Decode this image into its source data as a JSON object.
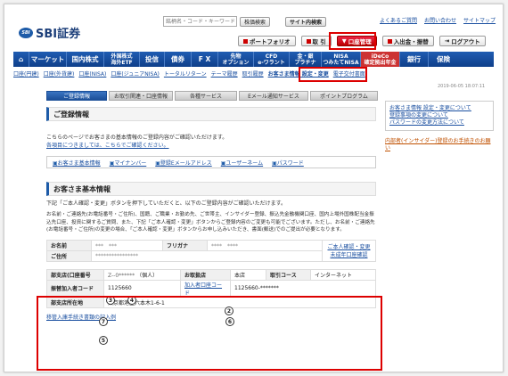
{
  "header": {
    "logo_text": "SBI証券",
    "logo_mark": "SBI",
    "search_placeholder": "銘柄名・コード・キーワード",
    "search_stock_button": "株価検索",
    "site_search_button": "サイト内検索",
    "top_links": [
      "よくあるご質問",
      "お問い合わせ",
      "サイトマップ"
    ],
    "portfolio": "ポートフォリオ",
    "trade": "取 引",
    "account_mgmt": "口座管理",
    "deposit": "入出金・振替",
    "logout": "ログアウト"
  },
  "nav": {
    "items": [
      "マーケット",
      "国内株式",
      "外国株式\n海外ETF",
      "投信",
      "債券",
      "F X",
      "先物\nオプション",
      "CFD\ne-ワラント",
      "金・銀\nプラチナ",
      "NISA\nつみたてNISA",
      "iDeCo\n確定拠出年金",
      "銀行",
      "保険"
    ]
  },
  "subnav": {
    "items": [
      "口座(円建)",
      "口座(外貨建)",
      "口座(NISA)",
      "口座(ジュニアNISA)",
      "トータルリターン",
      "テーマ履歴",
      "取引履歴",
      "お客さま情報 設定・変更",
      "電子交付書面"
    ]
  },
  "timestamp": "2019-06-05 18:07:11",
  "tabs": [
    "ご登録情報",
    "お取引関連・口座情報",
    "各種サービス",
    "Eメール通知サービス",
    "ポイントプログラム"
  ],
  "section1": {
    "title": "ご登録情報",
    "desc": "こちらのページでお客さまの基本情報のご登録内容がご確認いただけます。",
    "desc_link": "各項目につきましては、こちらでご確認ください。",
    "links": [
      "お客さま基本情報",
      "マイナンバー",
      "登録Eメールアドレス",
      "ユーザーネーム",
      "パスワード"
    ]
  },
  "section2": {
    "title": "お客さま基本情報",
    "line1": "下記「ご本人確認・変更」ボタンを押下していただくと、以下のご登録内容がご確認いただけます。",
    "line2": "お名前・ご連絡先(お電話番号・ご住所)、国籍、ご職業・お勤め先、ご世帯主、インサイダー登録、振込先金融機関口座、国内上場外国株配当金振込先口座、投資に関するご質問、また、下記「ご本人確認・変更」ボタンからご登録内容のご変更も可能でございます。ただし、お名前・ご連絡先(お電話番号・ご住所)の変更の場合、「ご本人確認・変更」ボタンからお申し込みいただき、書面(郵送)でのご提出が必要となります。",
    "name_label": "お名前",
    "name_value": "***　***",
    "furigana_label": "フリガナ",
    "furigana_value": "****　****",
    "address_label": "ご住所",
    "address_value": "****************",
    "side_link_1": "ご本人確認・変更",
    "side_link_2": "未成年口座確認"
  },
  "account": {
    "branch_label": "部支店(口座番号",
    "branch_value": "Z--0******",
    "personal": "（個人）",
    "office_label": "お取扱店",
    "office_value": "本店",
    "course_label": "取引コース",
    "course_value": "インターネット",
    "broker_label": "振替加入者コード",
    "broker_value": "1125660",
    "joint_label": "加入者口座コード",
    "joint_value": "1125660-*******",
    "location_label": "部支店所在地",
    "location_value": "東京都港区六本木1-6-1",
    "transfer_link": "移管入庫手続き書類の記入例",
    "markers": [
      "3",
      "4",
      "2",
      "7",
      "6",
      "5"
    ]
  },
  "sidebar": {
    "links": [
      "お客さま情報 設定・変更について",
      "登録事項の変更について",
      "パスワードの変更方法について"
    ],
    "insider_link": "内部者(インサイダー)登録のお手続きのお願い"
  }
}
